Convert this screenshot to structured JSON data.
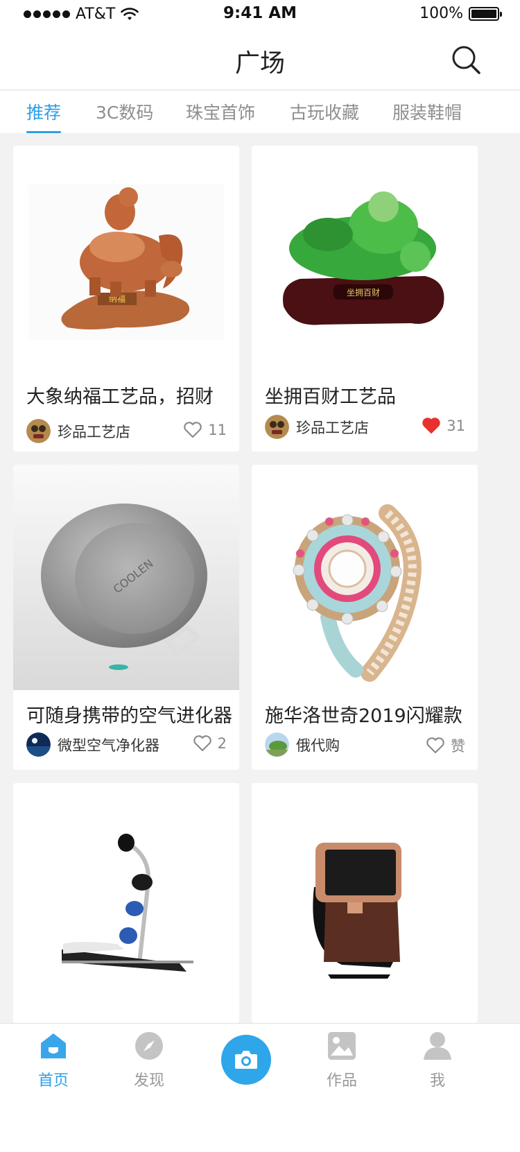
{
  "status": {
    "carrier": "AT&T",
    "time": "9:41 AM",
    "battery": "100%"
  },
  "nav": {
    "title": "广场"
  },
  "tabs": [
    {
      "label": "推荐",
      "active": true
    },
    {
      "label": "3C数码",
      "active": false
    },
    {
      "label": "珠宝首饰",
      "active": false
    },
    {
      "label": "古玩收藏",
      "active": false
    },
    {
      "label": "服装鞋帽",
      "active": false
    }
  ],
  "cards": [
    {
      "title": "大象纳福工艺品，招财",
      "shop": "珍品工艺店",
      "likes": "11",
      "liked": false,
      "image": "elephant-figurine"
    },
    {
      "title": "坐拥百财工艺品",
      "shop": "珍品工艺店",
      "likes": "31",
      "liked": true,
      "image": "jade-buddha"
    },
    {
      "title": "可随身携带的空气进化器",
      "shop": "微型空气净化器",
      "likes": "2",
      "liked": false,
      "image": "air-purifier",
      "engraving": "COOLEN"
    },
    {
      "title": "施华洛世奇2019闪耀款",
      "shop": "俄代购",
      "likes": "赞",
      "liked": false,
      "image": "jeweled-watch"
    },
    {
      "title": "",
      "shop": "",
      "likes": "",
      "liked": false,
      "image": "fitness-machine"
    },
    {
      "title": "",
      "shop": "",
      "likes": "",
      "liked": false,
      "image": "smart-watch"
    }
  ],
  "tabbar": {
    "items": [
      {
        "label": "首页",
        "icon": "home-icon",
        "active": true
      },
      {
        "label": "发现",
        "icon": "compass-icon",
        "active": false
      },
      {
        "label": "",
        "icon": "camera-icon",
        "active": false
      },
      {
        "label": "作品",
        "icon": "gallery-icon",
        "active": false
      },
      {
        "label": "我",
        "icon": "user-icon",
        "active": false
      }
    ]
  },
  "colors": {
    "accent": "#2e9ee6",
    "liked": "#e8312c",
    "inactive": "#999999"
  }
}
